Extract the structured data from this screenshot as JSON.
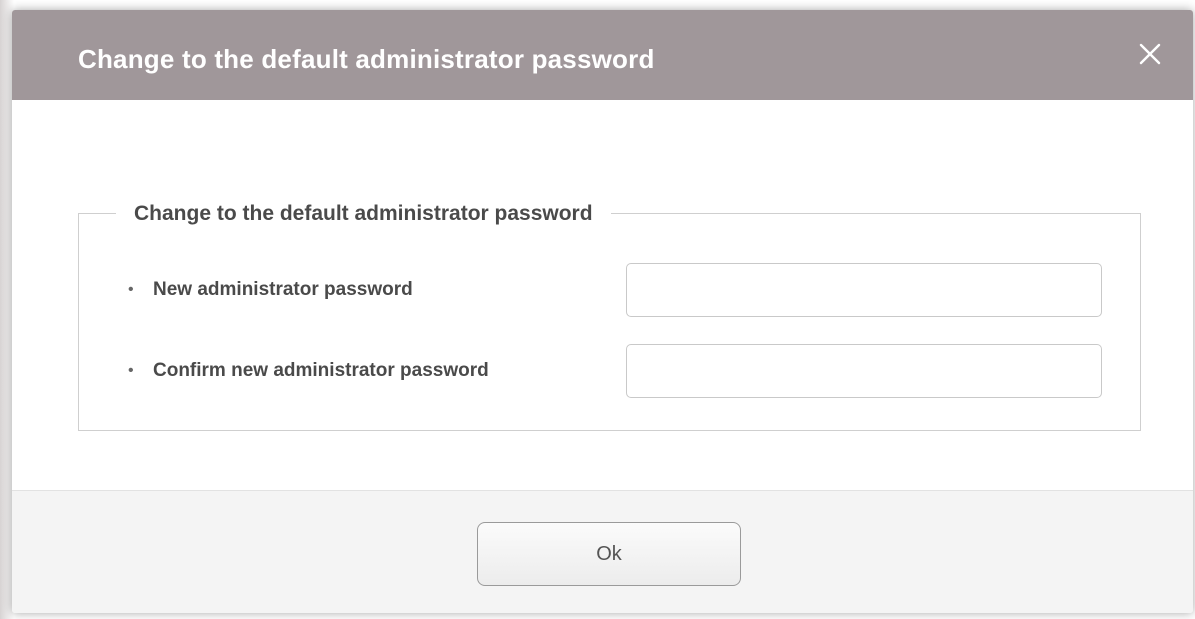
{
  "dialog": {
    "title": "Change to the default administrator password",
    "close_icon": "close-icon",
    "header_color": "#a0979a"
  },
  "form": {
    "legend": "Change to the default administrator password",
    "bullet": "•",
    "fields": [
      {
        "label": "New administrator password",
        "value": "",
        "placeholder": ""
      },
      {
        "label": "Confirm new administrator password",
        "value": "",
        "placeholder": ""
      }
    ]
  },
  "footer": {
    "ok_label": "Ok"
  }
}
